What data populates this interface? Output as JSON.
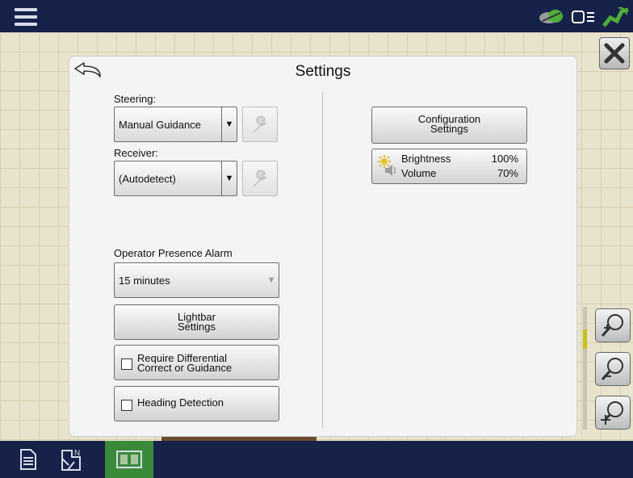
{
  "title": "Settings",
  "left": {
    "steering_label": "Steering:",
    "steering_value": "Manual Guidance",
    "receiver_label": "Receiver:",
    "receiver_value": "(Autodetect)",
    "alarm_label": "Operator Presence Alarm",
    "alarm_value": "15 minutes",
    "lightbar_line1": "Lightbar",
    "lightbar_line2": "Settings",
    "diff_line1": "Require Differential",
    "diff_line2": "Correct or Guidance",
    "heading_label": "Heading Detection"
  },
  "right": {
    "config_line1": "Configuration",
    "config_line2": "Settings",
    "brightness_label": "Brightness",
    "brightness_value": "100%",
    "volume_label": "Volume",
    "volume_value": "70%"
  },
  "checks": {
    "require_differential": false,
    "heading_detection": false
  },
  "colors": {
    "topbar": "#16224a",
    "active_tab": "#3a8a3a",
    "zoom_fill": "#c7c21a"
  },
  "icons": [
    "menu-icon",
    "gps-icon",
    "display-icon",
    "satellite-icon",
    "close-icon",
    "back-arrow-icon",
    "wrench-icon",
    "brightness-icon",
    "speaker-icon",
    "zoom-in-icon",
    "zoom-out-icon",
    "zoom-pan-icon",
    "document-icon",
    "field-map-icon",
    "split-view-icon"
  ]
}
